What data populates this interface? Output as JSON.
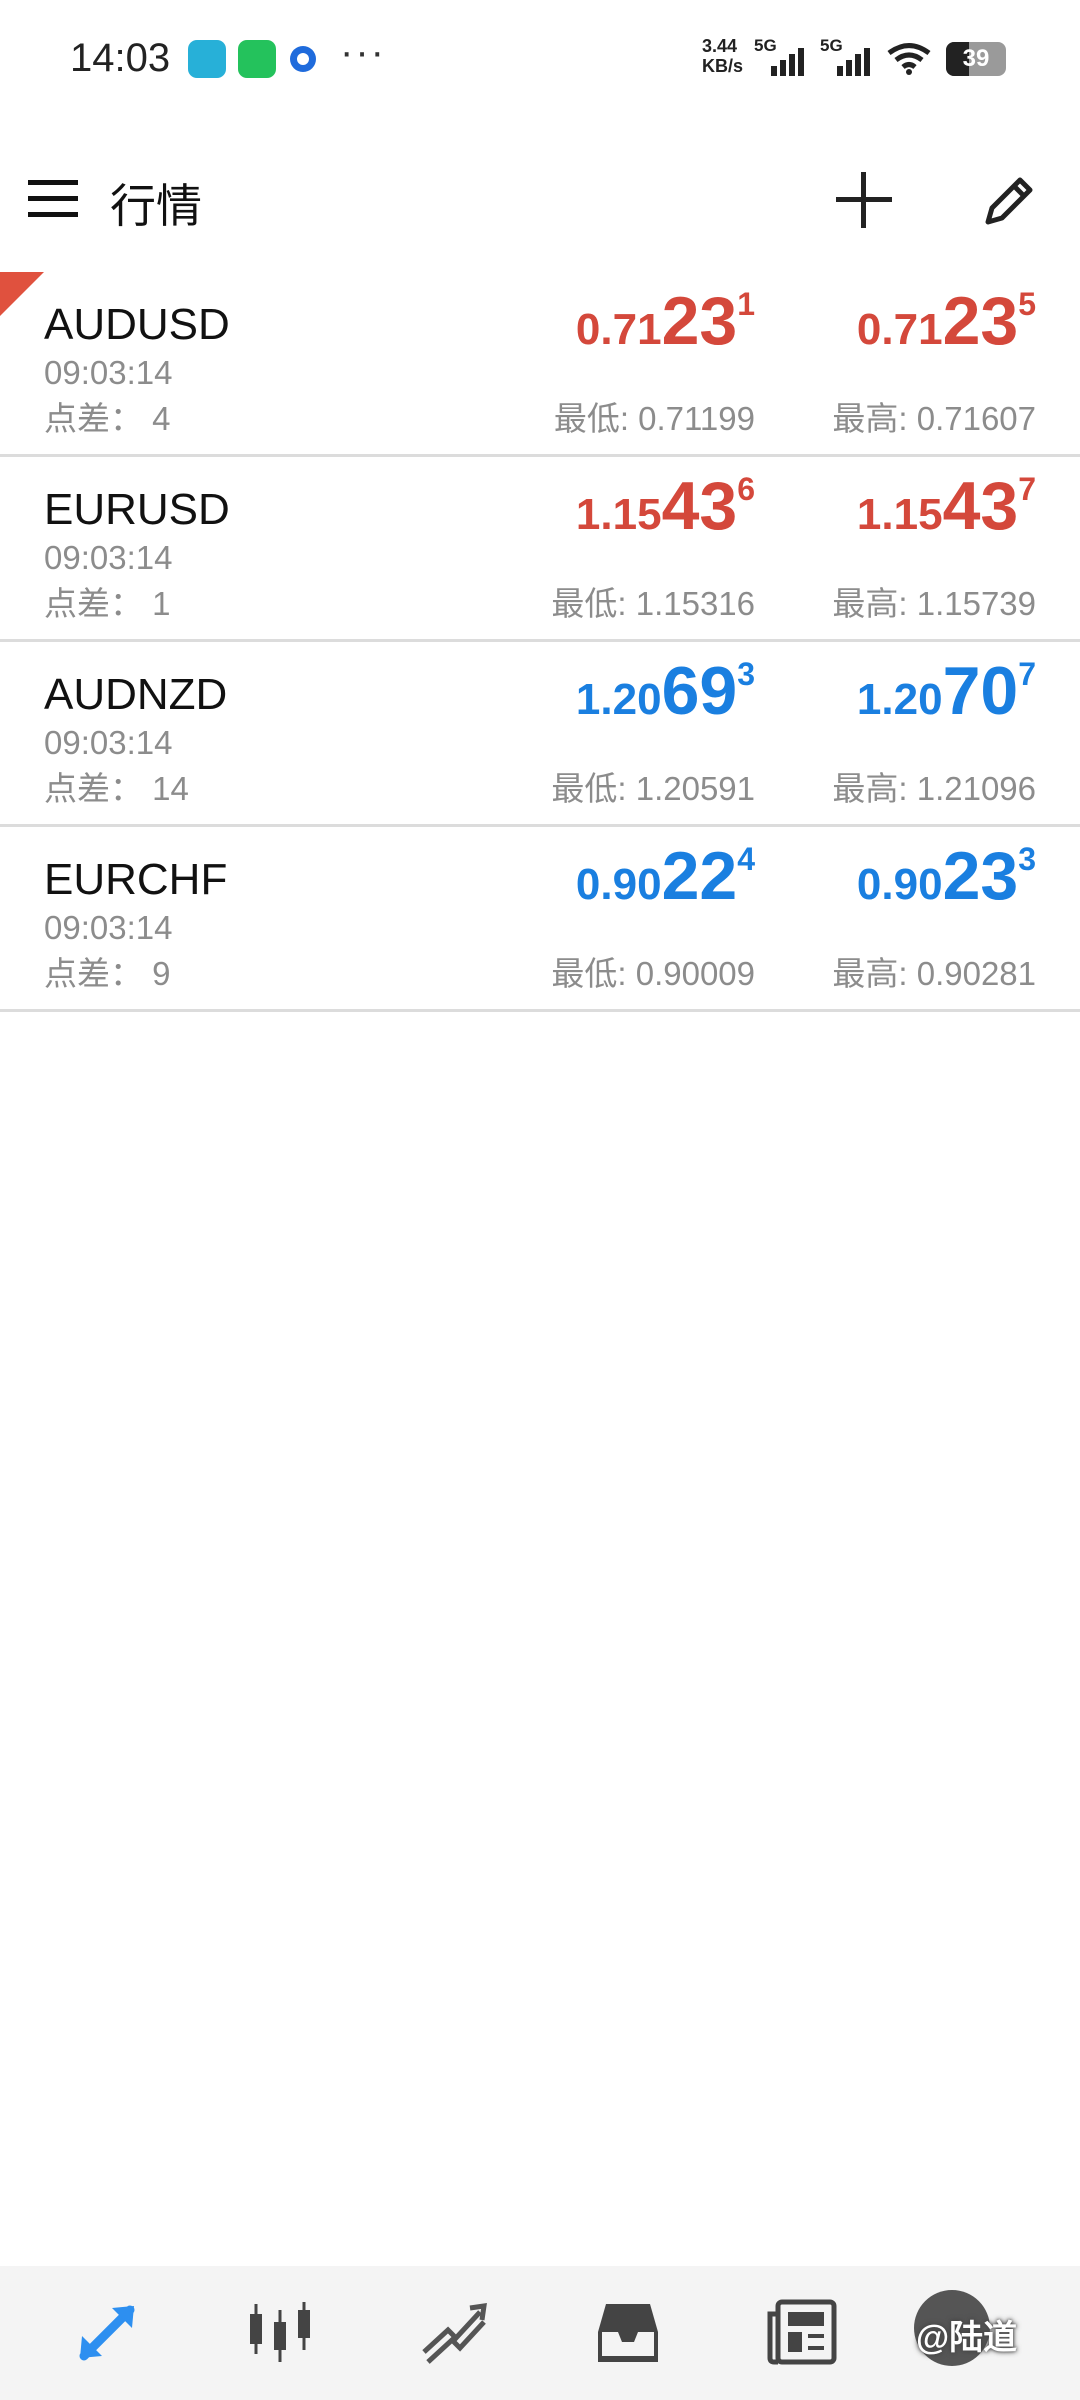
{
  "status_bar": {
    "time": "14:03",
    "net_speed_value": "3.44",
    "net_speed_unit": "KB/s",
    "sim1_label": "5G",
    "sim2_label": "5G",
    "battery": "39",
    "battery_level": 0.39,
    "more": "···",
    "icons": [
      "app-icon",
      "wechat-icon",
      "browser-icon",
      "signal-icon",
      "wifi-icon",
      "battery-icon"
    ]
  },
  "header": {
    "title": "行情",
    "icons": [
      "menu-icon",
      "add-icon",
      "edit-icon"
    ]
  },
  "quotes": [
    {
      "symbol": "AUDUSD",
      "time": "09:03:14",
      "spread_label": "点差：",
      "spread": "4",
      "direction": "down",
      "bid": {
        "prefix": "0.71",
        "big": "23",
        "sup": "1"
      },
      "ask": {
        "prefix": "0.71",
        "big": "23",
        "sup": "5"
      },
      "low": "最低: 0.71199",
      "high": "最高: 0.71607"
    },
    {
      "symbol": "EURUSD",
      "time": "09:03:14",
      "spread_label": "点差：",
      "spread": "1",
      "direction": "down",
      "bid": {
        "prefix": "1.15",
        "big": "43",
        "sup": "6"
      },
      "ask": {
        "prefix": "1.15",
        "big": "43",
        "sup": "7"
      },
      "low": "最低: 1.15316",
      "high": "最高: 1.15739"
    },
    {
      "symbol": "AUDNZD",
      "time": "09:03:14",
      "spread_label": "点差：",
      "spread": "14",
      "direction": "up",
      "bid": {
        "prefix": "1.20",
        "big": "69",
        "sup": "3"
      },
      "ask": {
        "prefix": "1.20",
        "big": "70",
        "sup": "7"
      },
      "low": "最低: 1.20591",
      "high": "最高: 1.21096"
    },
    {
      "symbol": "EURCHF",
      "time": "09:03:14",
      "spread_label": "点差：",
      "spread": "9",
      "direction": "up",
      "bid": {
        "prefix": "0.90",
        "big": "22",
        "sup": "4"
      },
      "ask": {
        "prefix": "0.90",
        "big": "23",
        "sup": "3"
      },
      "low": "最低: 0.90009",
      "high": "最高: 0.90281"
    }
  ],
  "bottom_nav": {
    "items": [
      "quotes-icon",
      "chart-icon",
      "trade-icon",
      "history-icon",
      "news-icon",
      "profile-icon"
    ],
    "active": "quotes-icon"
  },
  "watermark": "@陆道",
  "colors": {
    "down": "#d4483b",
    "up": "#1a7fe0",
    "active_nav": "#2d8ff0",
    "inactive_nav": "#444444"
  }
}
